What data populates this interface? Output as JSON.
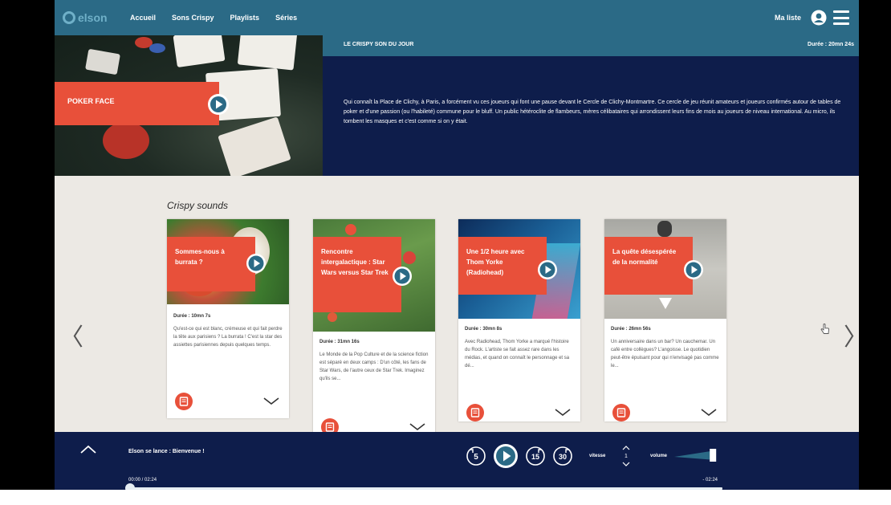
{
  "nav": {
    "logo_text": "elson",
    "links": [
      "Accueil",
      "Sons Crispy",
      "Playlists",
      "Séries"
    ],
    "my_list": "Ma liste",
    "colors": {
      "nav_bg": "#2b6a86",
      "accent": "#e8503a",
      "navy": "#0e1d4b"
    }
  },
  "hero": {
    "label": "POKER FACE",
    "section_tag": "LE CRISPY SON DU JOUR",
    "duration": "Durée : 20mn 24s",
    "description": "Qui connaît la Place de Clichy, à Paris, a forcément vu ces joueurs qui font une pause devant le Cercle de Clichy-Montmartre. Ce cercle de jeu réunit amateurs et joueurs confirmés autour de tables de poker et d'une passion (ou l'habileté) commune pour le bluff. Un public hétéroclite de flambeurs, mères célibataires qui arrondissent leurs fins de mois au joueurs de niveau international. Au micro, ils tombent les masques et c'est comme si on y était."
  },
  "section": {
    "title": "Crispy sounds"
  },
  "tiles": [
    {
      "tag": "Sommes-nous à burrata ?",
      "duration": "Durée : 10mn 7s",
      "text": "Qu'est-ce qui est blanc, crémeuse et qui fait perdre la tête aux parisiens ? La burrata ! C'est la star des assiettes parisiennes depuis quelques temps."
    },
    {
      "tag": "Rencontre intergalactique : Star Wars versus Star Trek",
      "duration": "Durée : 31mn 16s",
      "text": "Le Monde de la Pop Culture et de la science fiction est séparé en deux camps : D'un côté, les fans de Star Wars, de l'autre ceux de Star Trek. Imaginez qu'ils se..."
    },
    {
      "tag": "Une 1/2 heure avec Thom Yorke (Radiohead)",
      "duration": "Durée : 30mn 8s",
      "text": "Avec Radiohead, Thom Yorke a marqué l'histoire du Rock. L'artiste se fait assez rare dans les médias, et quand on connaît le personnage et sa dé..."
    },
    {
      "tag": "La quête désespérée de la normalité",
      "duration": "Durée : 26mn 56s",
      "text": "Un anniversaire dans un bar? Un cauchemar. Un café entre collègues? L'angoisse. Le quotidien peut-être épuisant pour qui n'envisagé pas comme le..."
    }
  ],
  "player": {
    "title": "Elson se lance : Bienvenue !",
    "time_current": "00:00 / 02:24",
    "time_remaining": "- 02:24",
    "speed_label": "vitesse",
    "speed_value": "1",
    "volume_label": "volume",
    "progress": 0.0,
    "volume_level": 0.85,
    "controls": [
      "rewind-5-icon",
      "play-icon",
      "forward-15-icon",
      "forward-30-icon"
    ]
  }
}
